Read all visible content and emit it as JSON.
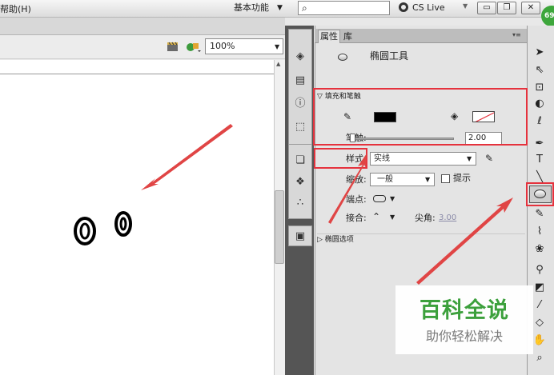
{
  "menu": {
    "help": "帮助(H)"
  },
  "top": {
    "workspace": "基本功能",
    "search_icon": "⌕",
    "cslive": "CS Live",
    "badge": "69"
  },
  "stage": {
    "zoom": "100%"
  },
  "panel": {
    "tabs": [
      "属性",
      "库"
    ],
    "tool_name": "椭圆工具",
    "fill_stroke_section": "填充和笔触",
    "stroke_label": "笔触:",
    "stroke_value": "2.00",
    "style_label": "样式:",
    "style_value": "实线",
    "scale_label": "缩放:",
    "scale_value": "一般",
    "hint_label": "提示",
    "cap_label": "端点:",
    "join_label": "接合:",
    "miter_label": "尖角:",
    "miter_value": "3.00",
    "ellipse_section": "椭圆选项"
  },
  "watermark": {
    "title": "百科全说",
    "subtitle": "助你轻松解决"
  },
  "colors": {
    "highlight": "#e5323d",
    "arrow": "#e04545",
    "brand_green": "#3ca03c"
  },
  "icons": [
    "search-icon",
    "cslive-icon",
    "scene-icon",
    "symbol-icon",
    "stroke-color-icon",
    "fill-color-icon",
    "selection-tool-icon",
    "oval-tool-icon",
    "pencil-icon",
    "brush-icon",
    "hand-icon",
    "zoom-icon"
  ]
}
